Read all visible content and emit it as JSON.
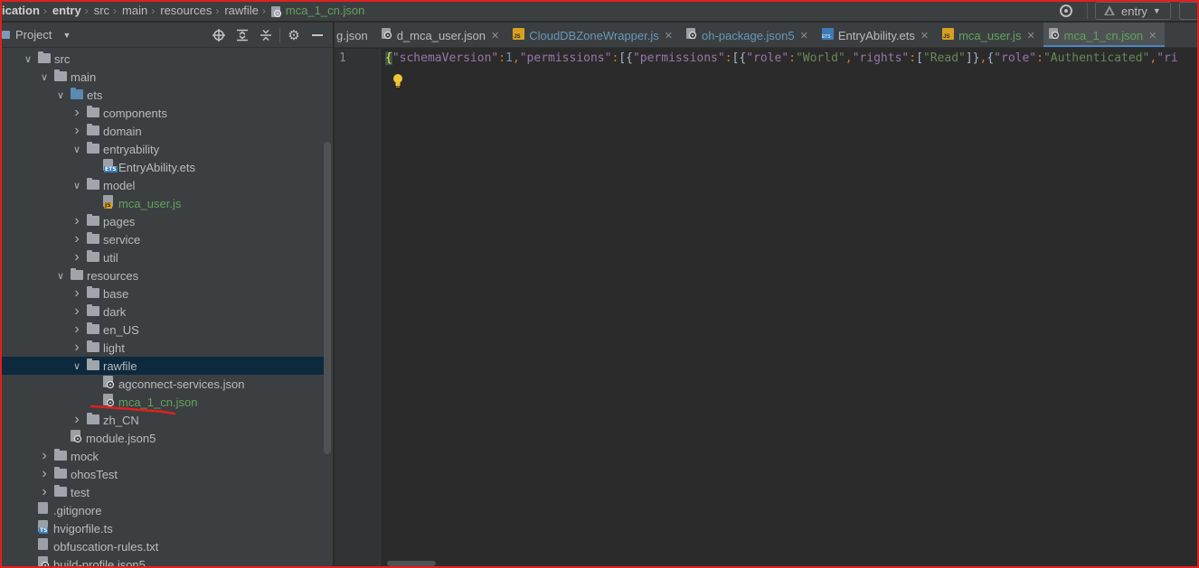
{
  "breadcrumb": [
    {
      "label": "ication",
      "style": "bold"
    },
    {
      "label": "entry",
      "style": "bold"
    },
    {
      "label": "src"
    },
    {
      "label": "main"
    },
    {
      "label": "resources"
    },
    {
      "label": "rawfile"
    },
    {
      "label": "mca_1_cn.json",
      "style": "green",
      "icon": "json-file-icon"
    }
  ],
  "run_config": {
    "label": "entry"
  },
  "project_panel": {
    "title": "Project",
    "toolbar_icons": [
      "locate-icon",
      "expand-all-icon",
      "collapse-all-icon",
      "gear-icon",
      "hide-icon"
    ]
  },
  "tree": [
    {
      "label": "src",
      "depth": 1,
      "arrow": "down",
      "icon": "folder"
    },
    {
      "label": "main",
      "depth": 2,
      "arrow": "down",
      "icon": "folder"
    },
    {
      "label": "ets",
      "depth": 3,
      "arrow": "down",
      "icon": "folder-blue"
    },
    {
      "label": "components",
      "depth": 4,
      "arrow": "right",
      "icon": "folder"
    },
    {
      "label": "domain",
      "depth": 4,
      "arrow": "right",
      "icon": "folder"
    },
    {
      "label": "entryability",
      "depth": 4,
      "arrow": "down",
      "icon": "folder"
    },
    {
      "label": "EntryAbility.ets",
      "depth": 5,
      "arrow": "",
      "icon": "ets"
    },
    {
      "label": "model",
      "depth": 4,
      "arrow": "down",
      "icon": "folder"
    },
    {
      "label": "mca_user.js",
      "depth": 5,
      "arrow": "",
      "icon": "js",
      "color": "green"
    },
    {
      "label": "pages",
      "depth": 4,
      "arrow": "right",
      "icon": "folder"
    },
    {
      "label": "service",
      "depth": 4,
      "arrow": "right",
      "icon": "folder"
    },
    {
      "label": "util",
      "depth": 4,
      "arrow": "right",
      "icon": "folder"
    },
    {
      "label": "resources",
      "depth": 3,
      "arrow": "down",
      "icon": "folder"
    },
    {
      "label": "base",
      "depth": 4,
      "arrow": "right",
      "icon": "folder"
    },
    {
      "label": "dark",
      "depth": 4,
      "arrow": "right",
      "icon": "folder"
    },
    {
      "label": "en_US",
      "depth": 4,
      "arrow": "right",
      "icon": "folder"
    },
    {
      "label": "light",
      "depth": 4,
      "arrow": "right",
      "icon": "folder"
    },
    {
      "label": "rawfile",
      "depth": 4,
      "arrow": "down",
      "icon": "folder",
      "selected": true
    },
    {
      "label": "agconnect-services.json",
      "depth": 5,
      "arrow": "",
      "icon": "json"
    },
    {
      "label": "mca_1_cn.json",
      "depth": 5,
      "arrow": "",
      "icon": "json",
      "color": "green"
    },
    {
      "label": "zh_CN",
      "depth": 4,
      "arrow": "right",
      "icon": "folder"
    },
    {
      "label": "module.json5",
      "depth": 3,
      "arrow": "",
      "icon": "json"
    },
    {
      "label": "mock",
      "depth": 2,
      "arrow": "right",
      "icon": "folder"
    },
    {
      "label": "ohosTest",
      "depth": 2,
      "arrow": "right",
      "icon": "folder"
    },
    {
      "label": "test",
      "depth": 2,
      "arrow": "right",
      "icon": "folder"
    },
    {
      "label": ".gitignore",
      "depth": 1,
      "arrow": "",
      "icon": "text"
    },
    {
      "label": "hvigorfile.ts",
      "depth": 1,
      "arrow": "",
      "icon": "ts"
    },
    {
      "label": "obfuscation-rules.txt",
      "depth": 1,
      "arrow": "",
      "icon": "text"
    },
    {
      "label": "build-profile.json5",
      "depth": 1,
      "arrow": "",
      "icon": "json"
    }
  ],
  "tabs": [
    {
      "label": "g.json",
      "icon": "",
      "color": "",
      "close": false
    },
    {
      "label": "d_mca_user.json",
      "icon": "json",
      "color": "",
      "close": true
    },
    {
      "label": "CloudDBZoneWrapper.js",
      "icon": "js",
      "color": "blue",
      "close": true
    },
    {
      "label": "oh-package.json5",
      "icon": "json",
      "color": "blue",
      "close": true
    },
    {
      "label": "EntryAbility.ets",
      "icon": "ets",
      "color": "",
      "close": true
    },
    {
      "label": "mca_user.js",
      "icon": "js",
      "color": "green",
      "close": true
    },
    {
      "label": "mca_1_cn.json",
      "icon": "json",
      "color": "green",
      "close": true,
      "active": true
    }
  ],
  "editor": {
    "line_number": "1",
    "tokens": [
      {
        "t": "{",
        "c": "brace-hl"
      },
      {
        "t": "\"schemaVersion\"",
        "c": "key"
      },
      {
        "t": ":",
        "c": "punct"
      },
      {
        "t": "1",
        "c": "num"
      },
      {
        "t": ",",
        "c": "punct"
      },
      {
        "t": "\"permissions\"",
        "c": "key"
      },
      {
        "t": ":",
        "c": "punct"
      },
      {
        "t": "[{",
        "c": "plain"
      },
      {
        "t": "\"permissions\"",
        "c": "key"
      },
      {
        "t": ":",
        "c": "punct"
      },
      {
        "t": "[{",
        "c": "plain"
      },
      {
        "t": "\"role\"",
        "c": "key"
      },
      {
        "t": ":",
        "c": "punct"
      },
      {
        "t": "\"World\"",
        "c": "str"
      },
      {
        "t": ",",
        "c": "punct"
      },
      {
        "t": "\"rights\"",
        "c": "key"
      },
      {
        "t": ":",
        "c": "punct"
      },
      {
        "t": "[",
        "c": "plain"
      },
      {
        "t": "\"Read\"",
        "c": "str"
      },
      {
        "t": "]}",
        "c": "plain"
      },
      {
        "t": ",",
        "c": "punct"
      },
      {
        "t": "{",
        "c": "plain"
      },
      {
        "t": "\"role\"",
        "c": "key"
      },
      {
        "t": ":",
        "c": "punct"
      },
      {
        "t": "\"Authenticated\"",
        "c": "str"
      },
      {
        "t": ",",
        "c": "punct"
      },
      {
        "t": "\"ri",
        "c": "key"
      }
    ]
  },
  "colors": {
    "accent": "#4a88c7",
    "green_label": "#62a35c",
    "blue_label": "#6897bb",
    "annotation_red": "#e0201f"
  }
}
